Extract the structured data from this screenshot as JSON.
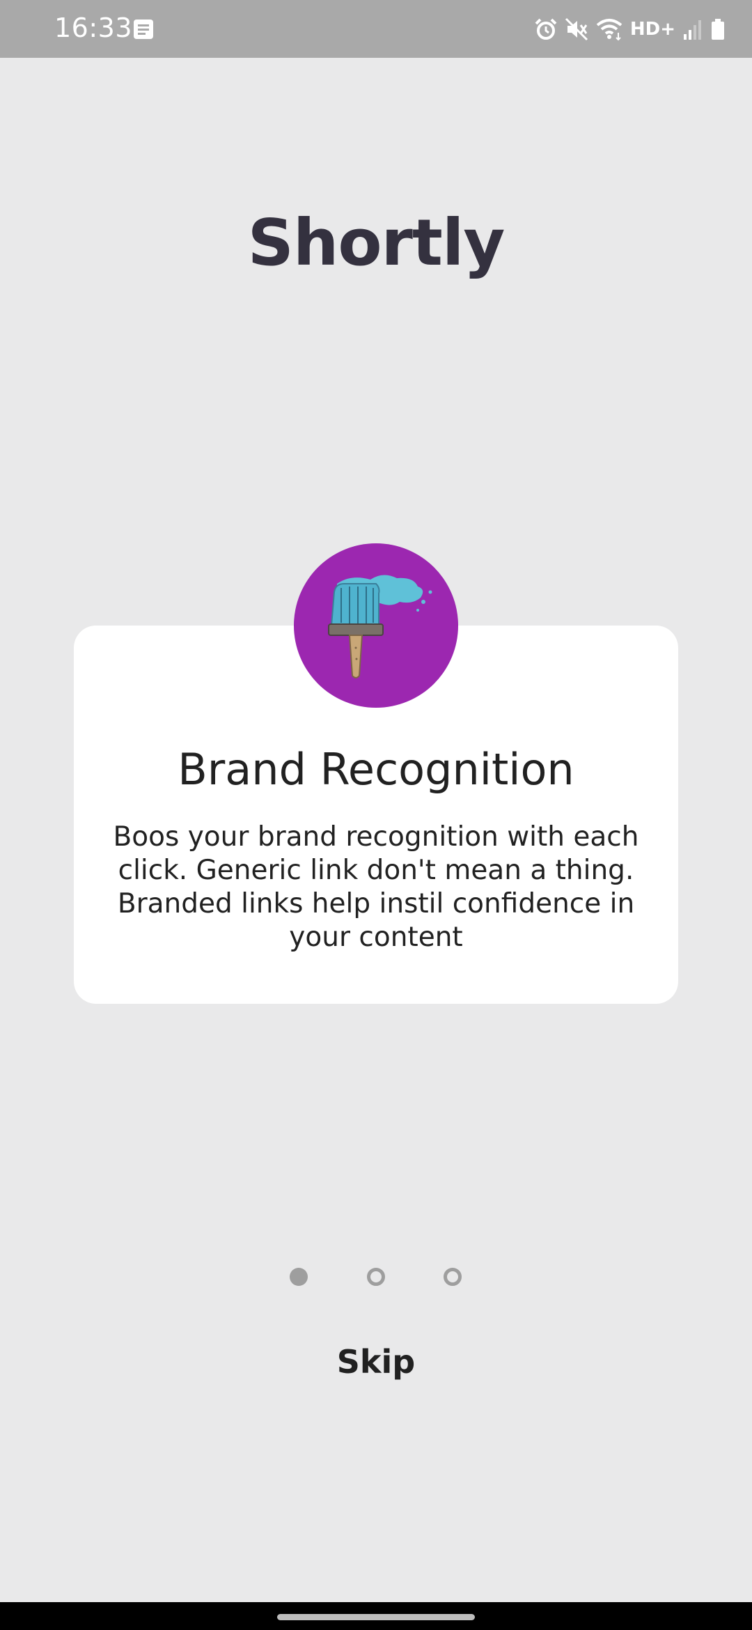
{
  "status_bar": {
    "time": "16:33",
    "network_label": "HD+",
    "icons": [
      "notification-icon",
      "alarm-icon",
      "vibrate-icon",
      "wifi-icon",
      "signal-icon",
      "battery-icon"
    ]
  },
  "app": {
    "title": "Shortly"
  },
  "onboarding": {
    "icon": "paintbrush-icon",
    "icon_bg_color": "#9c27b0",
    "title": "Brand Recognition",
    "body": "Boos your brand recognition with each click. Generic link don't mean a thing. Branded links help instil confidence in your content",
    "page_count": 3,
    "current_page": 1
  },
  "actions": {
    "skip_label": "Skip"
  }
}
